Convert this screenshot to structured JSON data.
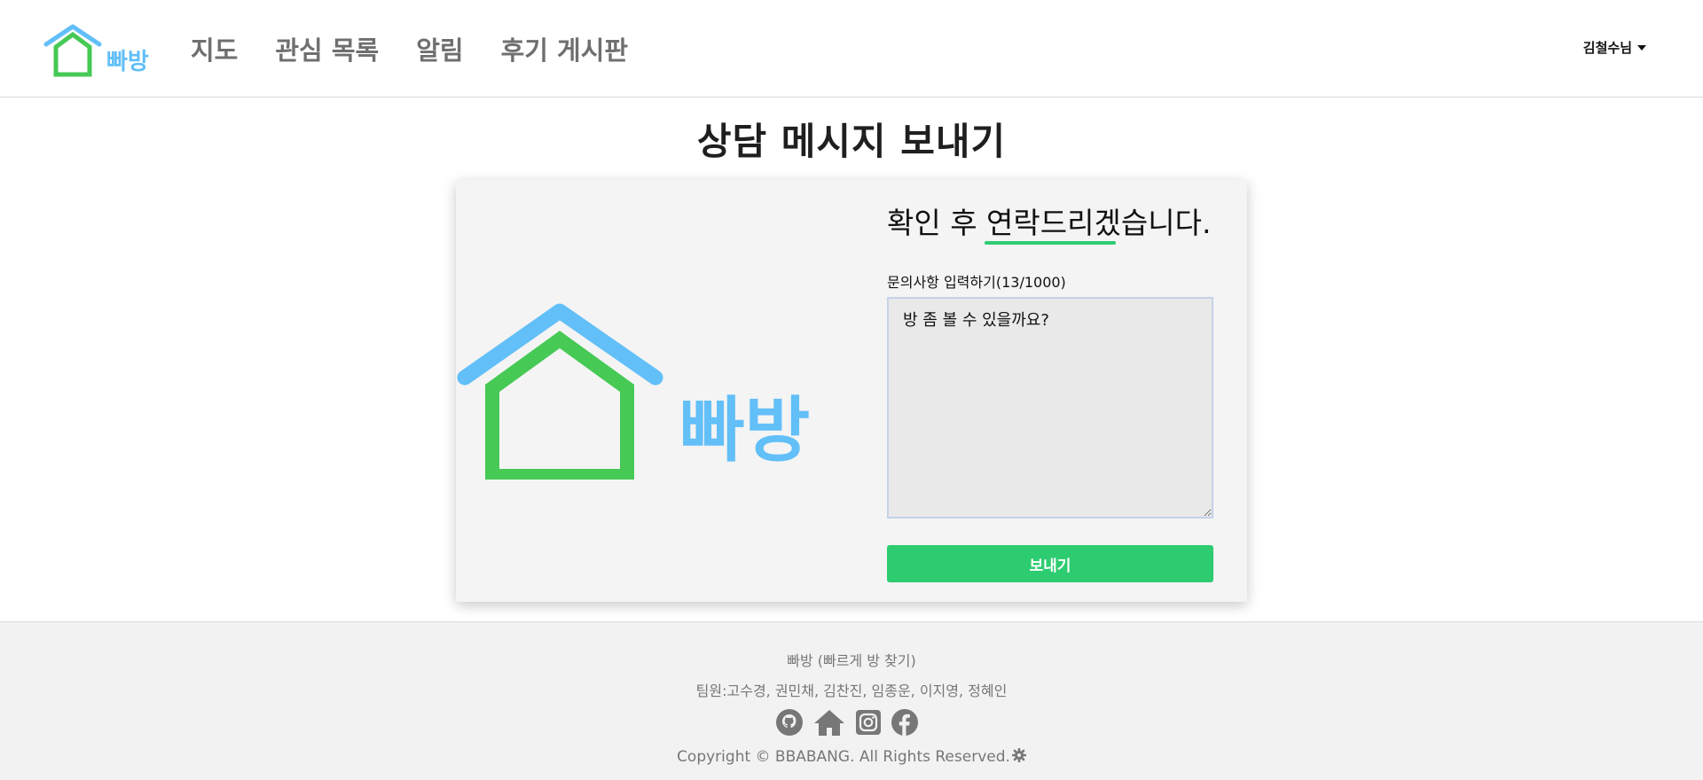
{
  "header": {
    "logo_text": "빠방",
    "nav": [
      "지도",
      "관심 목록",
      "알림",
      "후기 게시판"
    ],
    "user_label": "김철수님"
  },
  "page": {
    "title": "상담 메시지 보내기"
  },
  "card": {
    "logo_text": "빠방",
    "heading": "확인 후 연락드리겠습니다.",
    "field_label": "문의사항 입력하기(13/1000)",
    "message_value": "방 좀 볼 수 있을까요?",
    "submit_label": "보내기"
  },
  "footer": {
    "brand": "빠방 (빠르게 방 찾기)",
    "team": "팀원:고수경, 권민채, 김찬진, 임종운, 이지영, 정혜인",
    "icons": [
      "github-icon",
      "home-icon",
      "instagram-icon",
      "facebook-icon"
    ],
    "copyright": "Copyright © BBABANG. All Rights Reserved."
  },
  "colors": {
    "accent_green": "#2ecc71",
    "logo_green": "#46c955",
    "logo_blue": "#62bff8",
    "nav_gray": "#6f6f6f"
  }
}
